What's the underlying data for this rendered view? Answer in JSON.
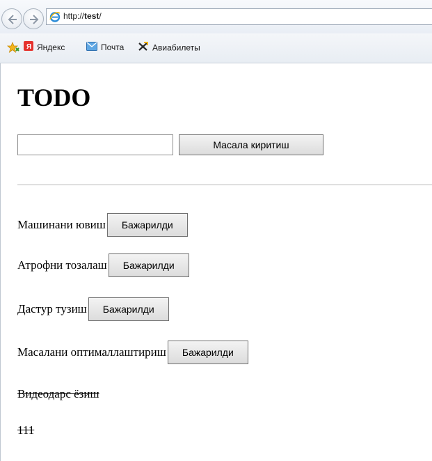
{
  "browser": {
    "url_prefix": "http://",
    "url_host": "test",
    "url_suffix": "/",
    "favorites": [
      {
        "icon": "yandex-icon",
        "label": "Яндекс"
      },
      {
        "icon": "mail-icon",
        "label": "Почта"
      },
      {
        "icon": "plane-icon",
        "label": "Авиабилеты"
      }
    ]
  },
  "page": {
    "title": "TODO",
    "input_value": "",
    "add_button_label": "Масала киритиш",
    "active_tasks": [
      {
        "text": "Машинани ювиш",
        "button": "Бажарилди"
      },
      {
        "text": "Атрофни тозалаш",
        "button": "Бажарилди"
      },
      {
        "text": "Дастур тузиш",
        "button": "Бажарилди"
      },
      {
        "text": "Масалани оптималлаштириш",
        "button": "Бажарилди"
      }
    ],
    "done_tasks": [
      {
        "text": "Видеодарс ёзиш"
      },
      {
        "text": "111"
      }
    ]
  }
}
